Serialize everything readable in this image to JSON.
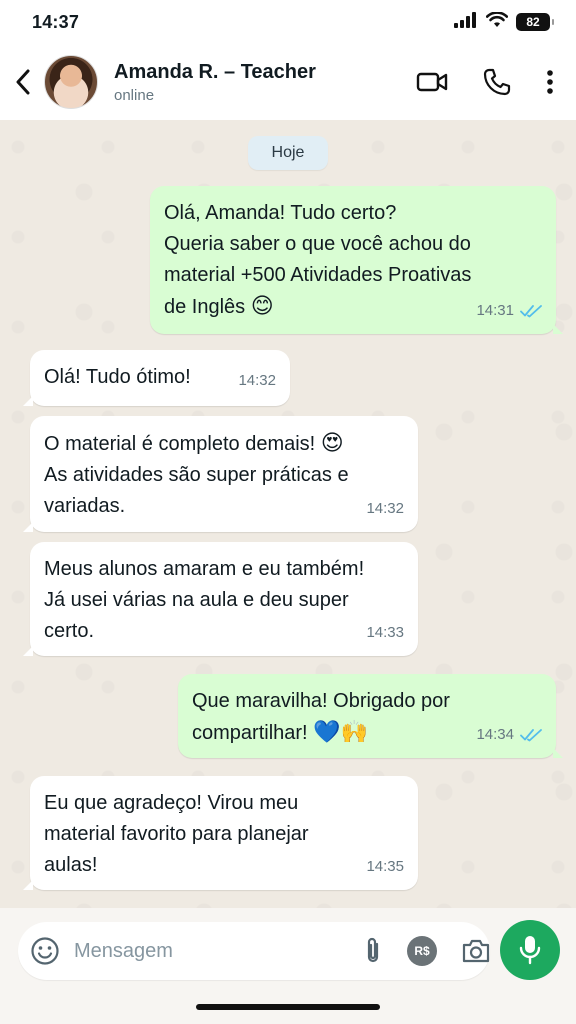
{
  "status_bar": {
    "time": "14:37",
    "battery": "82"
  },
  "header": {
    "contact_name": "Amanda R. – Teacher",
    "contact_status": "online",
    "icons": [
      "back-icon",
      "video-call-icon",
      "phone-icon",
      "more-icon"
    ]
  },
  "chat": {
    "day_label": "Hoje",
    "messages": [
      {
        "direction": "out",
        "text": "Olá, Amanda! Tudo certo?\nQueria saber o que você achou do\nmaterial +500 Atividades Proativas\nde Inglês",
        "emoji": "😊",
        "time": "14:31",
        "read": true
      },
      {
        "direction": "in",
        "text": "Olá! Tudo ótimo!",
        "time": "14:32"
      },
      {
        "direction": "in",
        "text": "O material é completo demais!",
        "emoji": "😍",
        "text2": "As atividades são super práticas e\nvariadas.",
        "time": "14:32"
      },
      {
        "direction": "in",
        "text": "Meus alunos amaram e eu também!\nJá usei várias na aula e deu super\ncerto.",
        "time": "14:33"
      },
      {
        "direction": "out",
        "text": "Que maravilha! Obrigado por\ncompartilhar!",
        "emoji": "💙🙌",
        "time": "14:34",
        "read": true
      },
      {
        "direction": "in",
        "text": "Eu que agradeço! Virou meu\nmaterial favorito para planejar\naulas!",
        "time": "14:35"
      }
    ]
  },
  "composer": {
    "placeholder": "Mensagem",
    "payment_label": "R$"
  },
  "colors": {
    "outgoing_bubble": "#d9fdd3",
    "incoming_bubble": "#ffffff",
    "chat_background": "#efeae2",
    "read_ticks": "#53bdeb",
    "mic_button": "#1da95f"
  }
}
